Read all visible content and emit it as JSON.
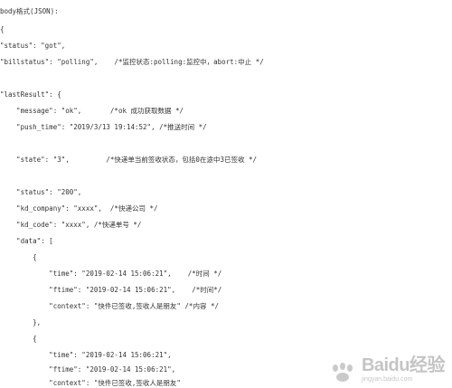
{
  "document": {
    "lines": [
      {
        "text": "body格式(JSON):"
      },
      {
        "text": "{"
      },
      {
        "text": "\"status\": \"got\","
      },
      {
        "text": "\"billstatus\": \"polling\",    /*监控状态:polling:监控中，abort:中止 */"
      },
      {
        "text": ""
      },
      {
        "text": "\"lastResult\": {"
      },
      {
        "text": "    \"message\": \"ok\",       /*ok 成功获取数据 */"
      },
      {
        "text": "    \"push_time\": \"2019/3/13 19:14:52\", /*推送时间 */"
      },
      {
        "text": ""
      },
      {
        "text": "    \"state\": \"3\",         /*快递单当前签收状态，包括0在途中3已签收 */"
      },
      {
        "text": ""
      },
      {
        "text": "    \"status\": \"200\","
      },
      {
        "text": "    \"kd_company\": \"xxxx\",  /*快递公司 */"
      },
      {
        "text": "    \"kd_code\": \"xxxx\", /*快递单号 */"
      },
      {
        "text": "    \"data\": ["
      },
      {
        "text": "        {"
      },
      {
        "text": "            \"time\": \"2019-02-14 15:06:21\",    /*时间 */"
      },
      {
        "text": "            \"ftime\": \"2019-02-14 15:06:21\",    /*时间*/"
      },
      {
        "text": "            \"context\": \"快件已签收,签收人是朋友\" /*内容 */"
      },
      {
        "text": "        },"
      },
      {
        "text": "        {"
      },
      {
        "text": "            \"time\": \"2019-02-14 15:06:21\","
      },
      {
        "text": "            \"ftime\": \"2019-02-14 15:06:21\","
      },
      {
        "text": "            \"context\": \"快件已签收,签收人是朋友\""
      }
    ]
  },
  "watermark": {
    "brand": "Baidu经验",
    "sub": "jingyan.baidu.com"
  },
  "colors": {
    "text": "#333333",
    "background": "#ffffff"
  }
}
